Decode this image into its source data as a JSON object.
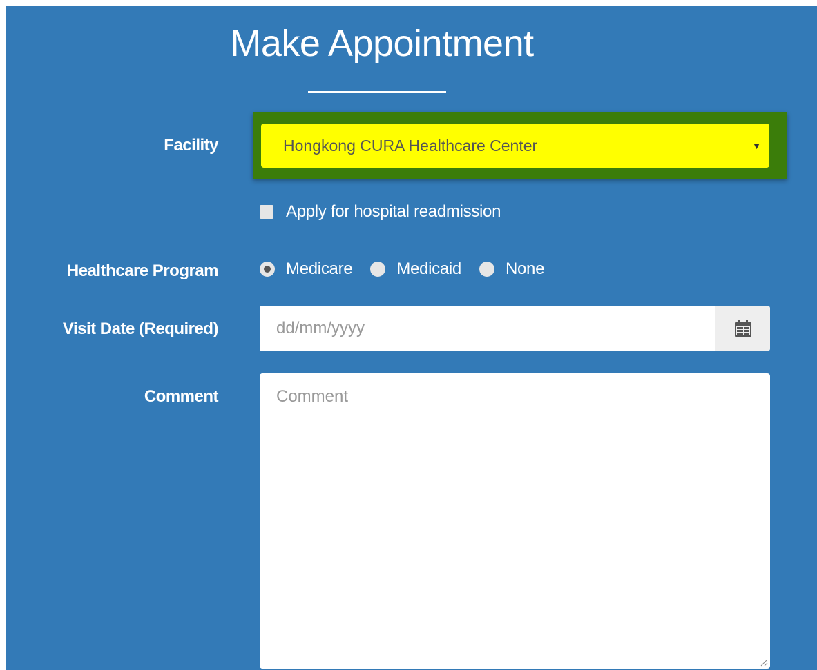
{
  "form": {
    "title": "Make Appointment",
    "facility": {
      "label": "Facility",
      "selected": "Hongkong CURA Healthcare Center",
      "highlight_color": "#ffff00",
      "outline_color": "#3b7d0a"
    },
    "readmission": {
      "label": "Apply for hospital readmission",
      "checked": false
    },
    "program": {
      "label": "Healthcare Program",
      "options": [
        {
          "label": "Medicare",
          "selected": true
        },
        {
          "label": "Medicaid",
          "selected": false
        },
        {
          "label": "None",
          "selected": false
        }
      ]
    },
    "visit_date": {
      "label": "Visit Date (Required)",
      "placeholder": "dd/mm/yyyy",
      "value": "",
      "icon": "calendar-icon"
    },
    "comment": {
      "label": "Comment",
      "placeholder": "Comment",
      "value": ""
    }
  },
  "colors": {
    "panel_background": "#337ab7",
    "text": "#ffffff"
  }
}
